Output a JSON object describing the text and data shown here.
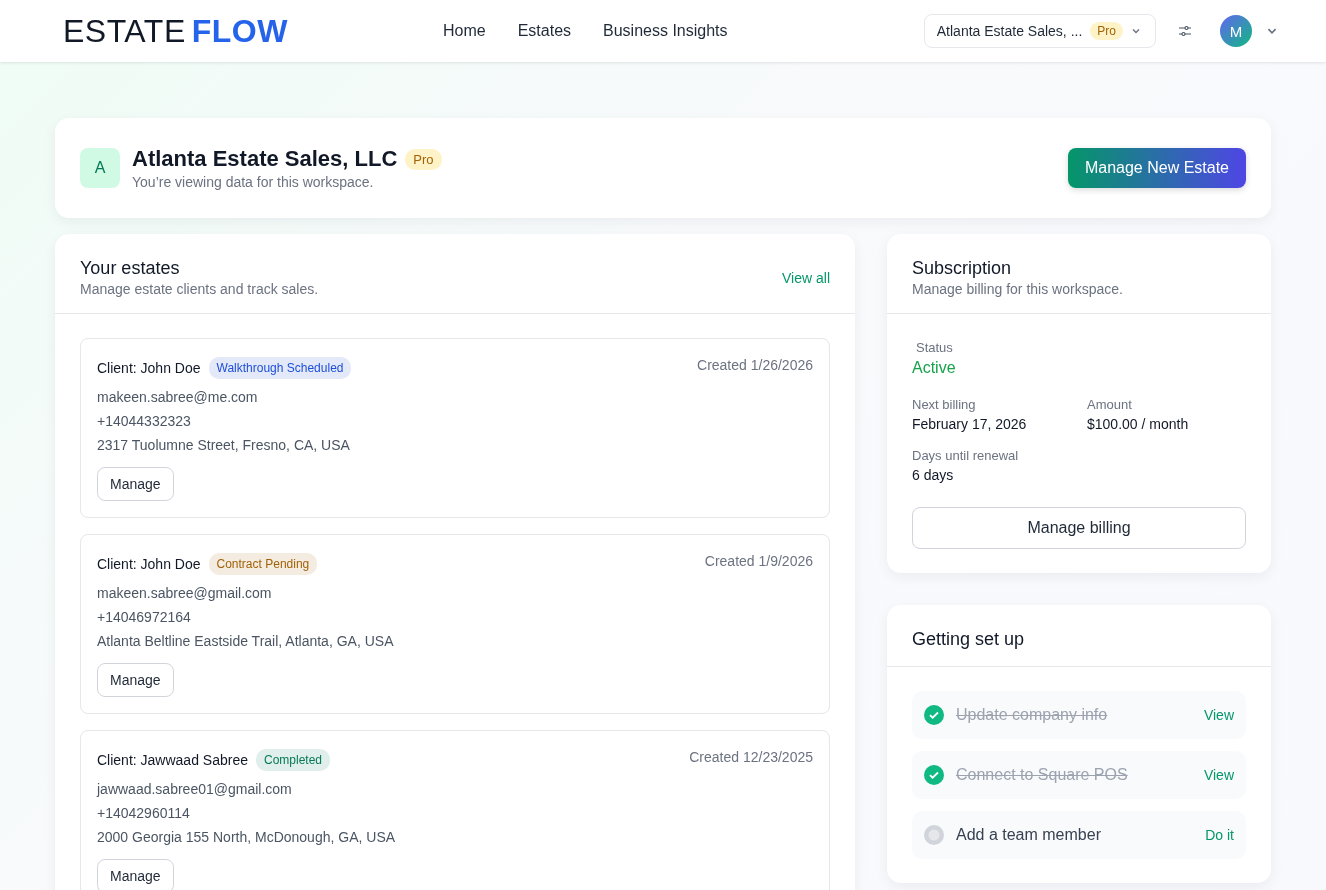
{
  "header": {
    "logo": {
      "part_1": "ESTATE",
      "part_2": "FLOW"
    },
    "nav": [
      {
        "label": "Home"
      },
      {
        "label": "Estates"
      },
      {
        "label": "Business Insights"
      }
    ],
    "workspace_selector": {
      "name": "Atlanta Estate Sales, ...",
      "badge": "Pro"
    },
    "avatar": "M"
  },
  "workspace": {
    "initial": "A",
    "name": "Atlanta Estate Sales, LLC",
    "badge": "Pro",
    "subtitle": "You’re viewing data for this workspace.",
    "action": "Manage New Estate"
  },
  "estates": {
    "title": "Your estates",
    "subtitle": "Manage estate clients and track sales.",
    "link": "View all",
    "items": [
      {
        "client": "Client: John Doe",
        "status": {
          "label": "Walkthrough Scheduled",
          "color": "#1d4ed8"
        },
        "created": "Created 1/26/2026",
        "email": "makeen.sabree@me.com",
        "phone": "+14044332323",
        "address": "2317 Tuolumne Street, Fresno, CA, USA",
        "action": "Manage"
      },
      {
        "client": "Client: John Doe",
        "status": {
          "label": "Contract Pending",
          "color": "#a16207"
        },
        "created": "Created 1/9/2026",
        "email": "makeen.sabree@gmail.com",
        "phone": "+14046972164",
        "address": "Atlanta Beltline Eastside Trail, Atlanta, GA, USA",
        "action": "Manage"
      },
      {
        "client": "Client: Jawwaad Sabree",
        "status": {
          "label": "Completed",
          "color": "#047857"
        },
        "created": "Created 12/23/2025",
        "email": "jawwaad.sabree01@gmail.com",
        "phone": "+14042960114",
        "address": "2000 Georgia 155 North, McDonough, GA, USA",
        "action": "Manage"
      }
    ]
  },
  "subscription": {
    "title": "Subscription",
    "subtitle": "Manage billing for this workspace.",
    "status_label": "Status",
    "status": "Active",
    "fields": [
      {
        "label": "Next billing",
        "value": "February 17, 2026"
      },
      {
        "label": "Amount",
        "value": "$100.00 / month"
      },
      {
        "label": "Days until renewal",
        "value": "6 days"
      }
    ],
    "action": "Manage billing"
  },
  "setup": {
    "title": "Getting set up",
    "items": [
      {
        "label": "Update company info",
        "done": true,
        "action": "View"
      },
      {
        "label": "Connect to Square POS",
        "done": true,
        "action": "View"
      },
      {
        "label": "Add a team member",
        "done": false,
        "action": "Do it"
      }
    ]
  }
}
